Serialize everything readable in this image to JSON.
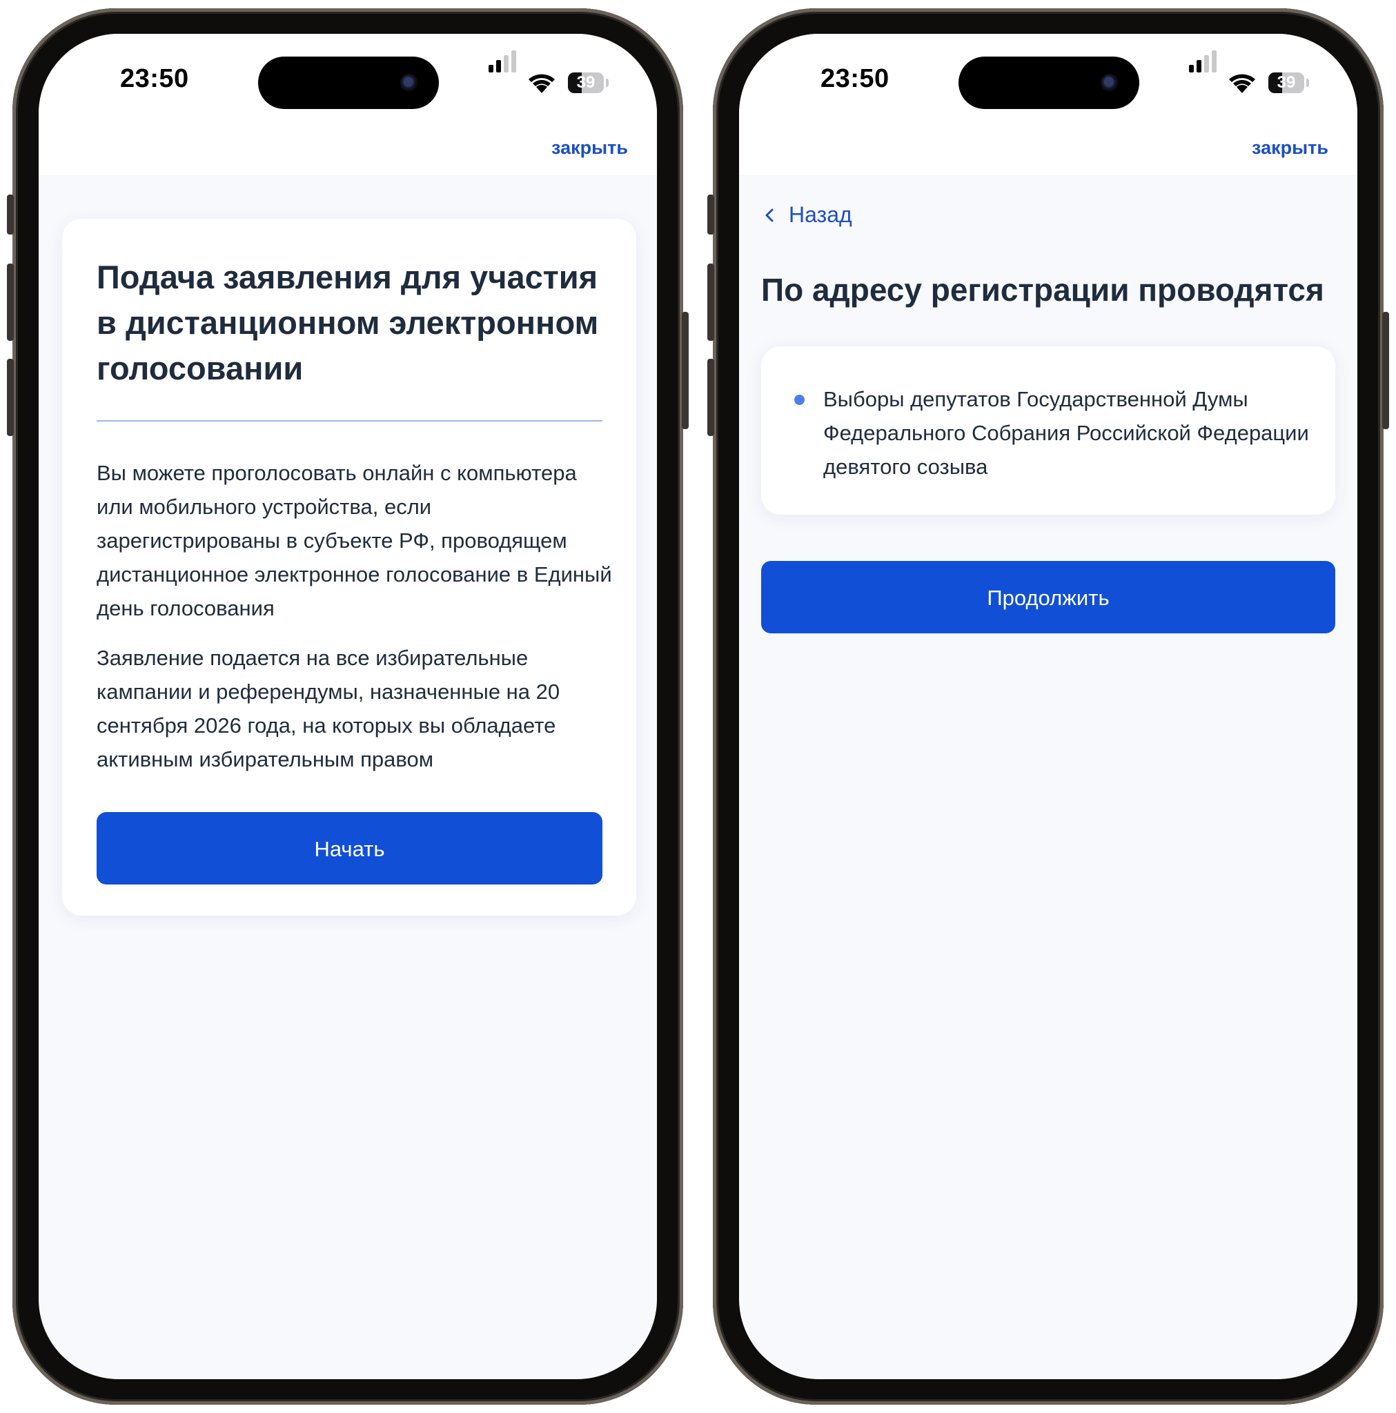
{
  "colors": {
    "accent": "#1150d6",
    "link": "#1b4fc4",
    "text": "#1f2c3d",
    "divider": "#9cb9e4",
    "bullet": "#4a7fe6"
  },
  "status_bar": {
    "time": "23:50",
    "battery_level": "39",
    "battery_fraction": 0.39,
    "signal_bars_active": 2,
    "signal_bars_total": 4
  },
  "screen_start": {
    "close_label": "закрыть",
    "title": "Подача заявления для участия в дистанционном электронном голосовании",
    "paragraphs": [
      "Вы можете проголосовать онлайн с компьютера или мобильного устройства, если зарегистрированы в субъекте РФ, проводящем дистанционное электронное голосование в Единый день голосования",
      "Заявление подается на все избирательные кампании и референдумы, назначенные на 20 сентября 2026 года, на которых вы обладаете активным избирательным правом"
    ],
    "start_button": "Начать"
  },
  "screen_elections": {
    "close_label": "закрыть",
    "back_label": "Назад",
    "title": "По адресу регистрации проводятся",
    "elections": [
      "Выборы депутатов Государственной Думы Федерального Собрания Российской Федерации девятого созыва"
    ],
    "continue_button": "Продолжить"
  },
  "icons": {
    "signal": "cellular-signal-icon",
    "wifi": "wifi-icon",
    "battery": "battery-icon",
    "back": "chevron-left-icon"
  }
}
